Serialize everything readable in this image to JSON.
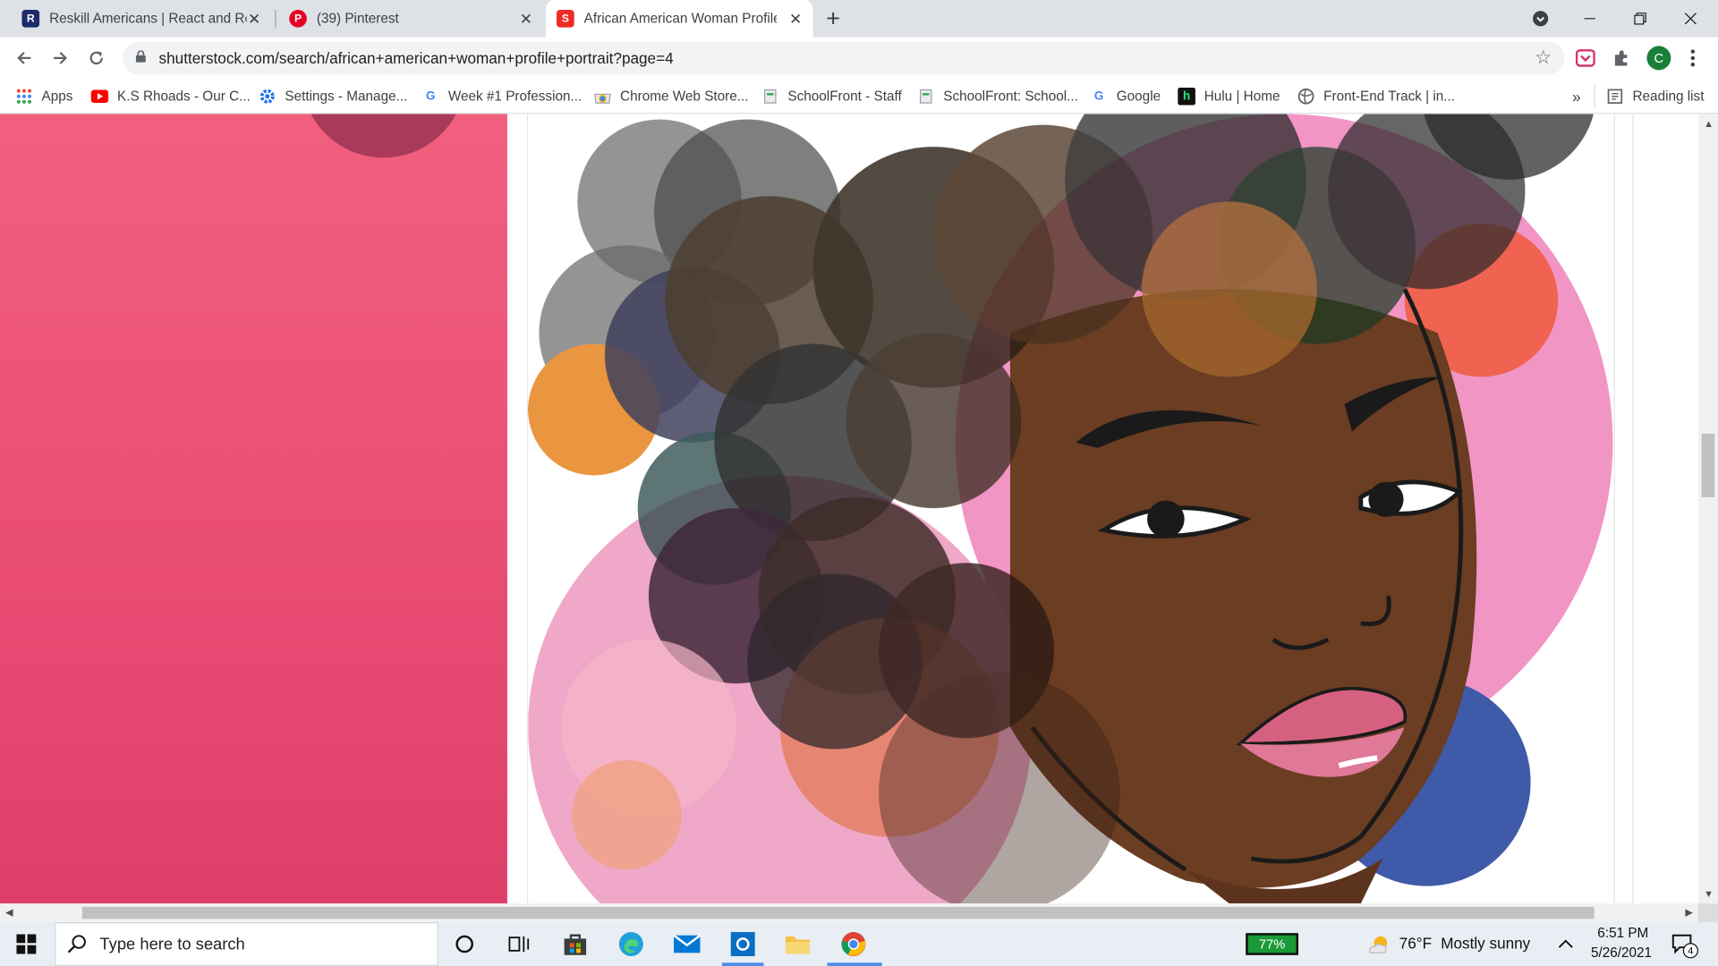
{
  "browser": {
    "tabs": [
      {
        "title": "Reskill Americans | React and Rea",
        "favicon": "reskill-favicon",
        "active": false
      },
      {
        "title": "(39) Pinterest",
        "favicon": "pinterest-favicon",
        "active": false
      },
      {
        "title": "African American Woman Profile",
        "favicon": "shutterstock-favicon",
        "active": true
      }
    ],
    "new_tab": "+",
    "url": "shutterstock.com/search/african+american+woman+profile+portrait?page=4",
    "profile_initial": "C"
  },
  "bookmarks": {
    "items": [
      {
        "label": "Apps",
        "icon": "apps-grid-icon"
      },
      {
        "label": "K.S Rhoads - Our C...",
        "icon": "youtube-icon"
      },
      {
        "label": "Settings - Manage...",
        "icon": "gear-icon"
      },
      {
        "label": "Week #1 Profession...",
        "icon": "google-icon"
      },
      {
        "label": "Chrome Web Store...",
        "icon": "webstore-icon"
      },
      {
        "label": "SchoolFront - Staff",
        "icon": "schoolfront-icon"
      },
      {
        "label": "SchoolFront: School...",
        "icon": "schoolfront-icon"
      },
      {
        "label": "Google",
        "icon": "google-icon"
      },
      {
        "label": "Hulu | Home",
        "icon": "hulu-icon"
      },
      {
        "label": "Front-End Track | in...",
        "icon": "globe-icon"
      }
    ],
    "overflow": "»",
    "reading_list": "Reading list"
  },
  "taskbar": {
    "search_placeholder": "Type here to search",
    "battery": "77%",
    "weather_temp": "76°F",
    "weather_desc": "Mostly sunny",
    "time": "6:51 PM",
    "date": "5/26/2021",
    "notifications": "4"
  }
}
